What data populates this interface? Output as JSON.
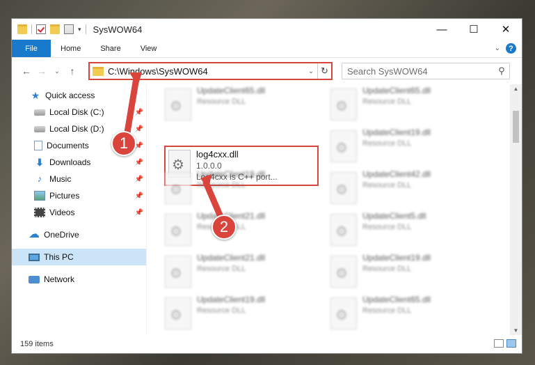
{
  "window": {
    "title": "SysWOW64",
    "controls": {
      "minimize": "—",
      "maximize": "☐",
      "close": "✕"
    }
  },
  "ribbon": {
    "tabs": [
      "File",
      "Home",
      "Share",
      "View"
    ],
    "collapse_icon": "chevron-down-icon",
    "help": "?"
  },
  "nav": {
    "address_path": "C:\\Windows\\SysWOW64",
    "search_placeholder": "Search SysWOW64"
  },
  "sidebar": {
    "quick_access": "Quick access",
    "items": [
      {
        "label": "Local Disk (C:)",
        "icon": "disk-icon",
        "pinned": true
      },
      {
        "label": "Local Disk (D:)",
        "icon": "disk-icon",
        "pinned": true
      },
      {
        "label": "Documents",
        "icon": "documents-icon",
        "pinned": true
      },
      {
        "label": "Downloads",
        "icon": "downloads-icon",
        "pinned": true
      },
      {
        "label": "Music",
        "icon": "music-icon",
        "pinned": true
      },
      {
        "label": "Pictures",
        "icon": "pictures-icon",
        "pinned": true
      },
      {
        "label": "Videos",
        "icon": "videos-icon",
        "pinned": true
      }
    ],
    "onedrive": "OneDrive",
    "this_pc": "This PC",
    "network": "Network"
  },
  "files": {
    "focused": {
      "name": "log4cxx.dll",
      "version": "1.0.0.0",
      "description": "Log4cxx is C++ port..."
    },
    "tiles": [
      {
        "name": "UpdateClient65.dll",
        "sub": "Resource DLL"
      },
      {
        "name": "UpdateClient65.dll",
        "sub": "Resource DLL"
      },
      {
        "name": "UpdateClient19.dll",
        "sub": "Resource DLL"
      },
      {
        "name": "UpdateClient19.dll",
        "sub": "Resource DLL"
      },
      {
        "name": "UpdateClient42.dll",
        "sub": "Resource DLL"
      },
      {
        "name": "UpdateClient21.dll",
        "sub": "Resource DLL"
      },
      {
        "name": "UpdateClient5.dll",
        "sub": "Resource DLL"
      },
      {
        "name": "UpdateClient21.dll",
        "sub": "Resource DLL"
      },
      {
        "name": "UpdateClient19.dll",
        "sub": "Resource DLL"
      },
      {
        "name": "UpdateClient19.dll",
        "sub": "Resource DLL"
      },
      {
        "name": "UpdateClient65.dll",
        "sub": "Resource DLL"
      }
    ]
  },
  "status": {
    "item_count": "159 items"
  },
  "annotations": {
    "step1": "1",
    "step2": "2",
    "color": "#d9443c"
  }
}
